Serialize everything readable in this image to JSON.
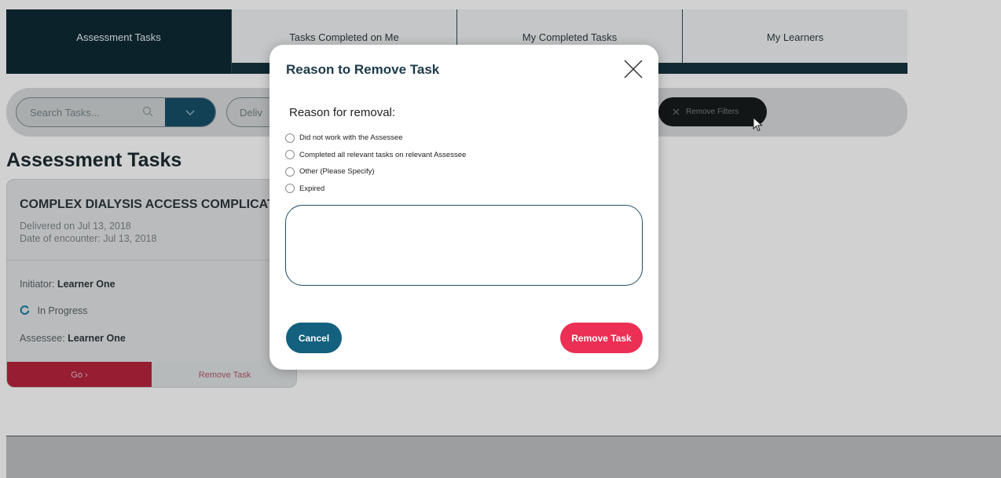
{
  "tabs": [
    {
      "label": "Assessment Tasks"
    },
    {
      "label": "Tasks Completed on Me"
    },
    {
      "label": "My Completed Tasks"
    },
    {
      "label": "My Learners"
    }
  ],
  "filters": {
    "search_placeholder": "Search Tasks...",
    "delivered_label": "Deliv",
    "remove_filters_label": "Remove Filters"
  },
  "section_title": "Assessment Tasks",
  "task_card": {
    "title": "COMPLEX DIALYSIS ACCESS COMPLICATION",
    "delivered": "Delivered on Jul 13, 2018",
    "encounter": "Date of encounter: Jul 13, 2018",
    "initiator_label": "Initiator:",
    "initiator_value": "Learner One",
    "status": "In Progress",
    "assessee_label": "Assessee:",
    "assessee_value": "Learner One",
    "go_label": "Go ›",
    "remove_label": "Remove Task"
  },
  "modal": {
    "title": "Reason to Remove Task",
    "reason_label": "Reason for removal:",
    "options": [
      {
        "label": "Did not work with the Assessee"
      },
      {
        "label": "Completed all relevant tasks on relevant Assessee"
      },
      {
        "label": "Other (Please Specify)"
      },
      {
        "label": "Expired"
      }
    ],
    "textarea_value": "",
    "cancel_label": "Cancel",
    "remove_label": "Remove Task"
  },
  "colors": {
    "primary": "#13607f",
    "danger": "#ec2f54",
    "dark_nav": "#16343f"
  }
}
